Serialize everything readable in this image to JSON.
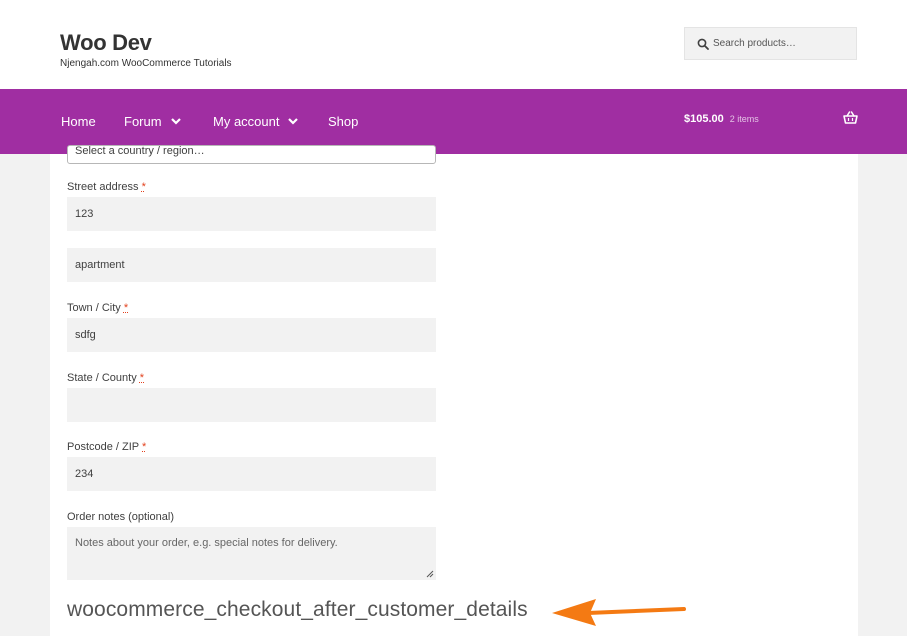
{
  "header": {
    "site_title": "Woo Dev",
    "tagline": "Njengah.com WooCommerce Tutorials",
    "search_placeholder": "Search products…"
  },
  "nav": {
    "items": [
      {
        "label": "Home",
        "has_dropdown": false
      },
      {
        "label": "Forum",
        "has_dropdown": true
      },
      {
        "label": "My account",
        "has_dropdown": true
      },
      {
        "label": "Shop",
        "has_dropdown": false
      }
    ],
    "cart_total": "$105.00",
    "cart_count": "2 items"
  },
  "form": {
    "country_select": "Select a country / region…",
    "street_label": "Street address",
    "street_value": "123",
    "apartment_value": "apartment",
    "city_label": "Town / City",
    "city_value": "sdfg",
    "state_label": "State / County",
    "state_value": "",
    "postcode_label": "Postcode / ZIP",
    "postcode_value": "234",
    "notes_label": "Order notes (optional)",
    "notes_placeholder": "Notes about your order, e.g. special notes for delivery.",
    "required_mark": "*"
  },
  "annotation": {
    "hook_text": "woocommerce_checkout_after_customer_details"
  },
  "colors": {
    "nav_background": "#a02ea2",
    "required": "#e2401c",
    "arrow": "#f47a13"
  },
  "icons": [
    "search-icon",
    "chevron-down-icon",
    "basket-icon",
    "arrow-icon"
  ]
}
